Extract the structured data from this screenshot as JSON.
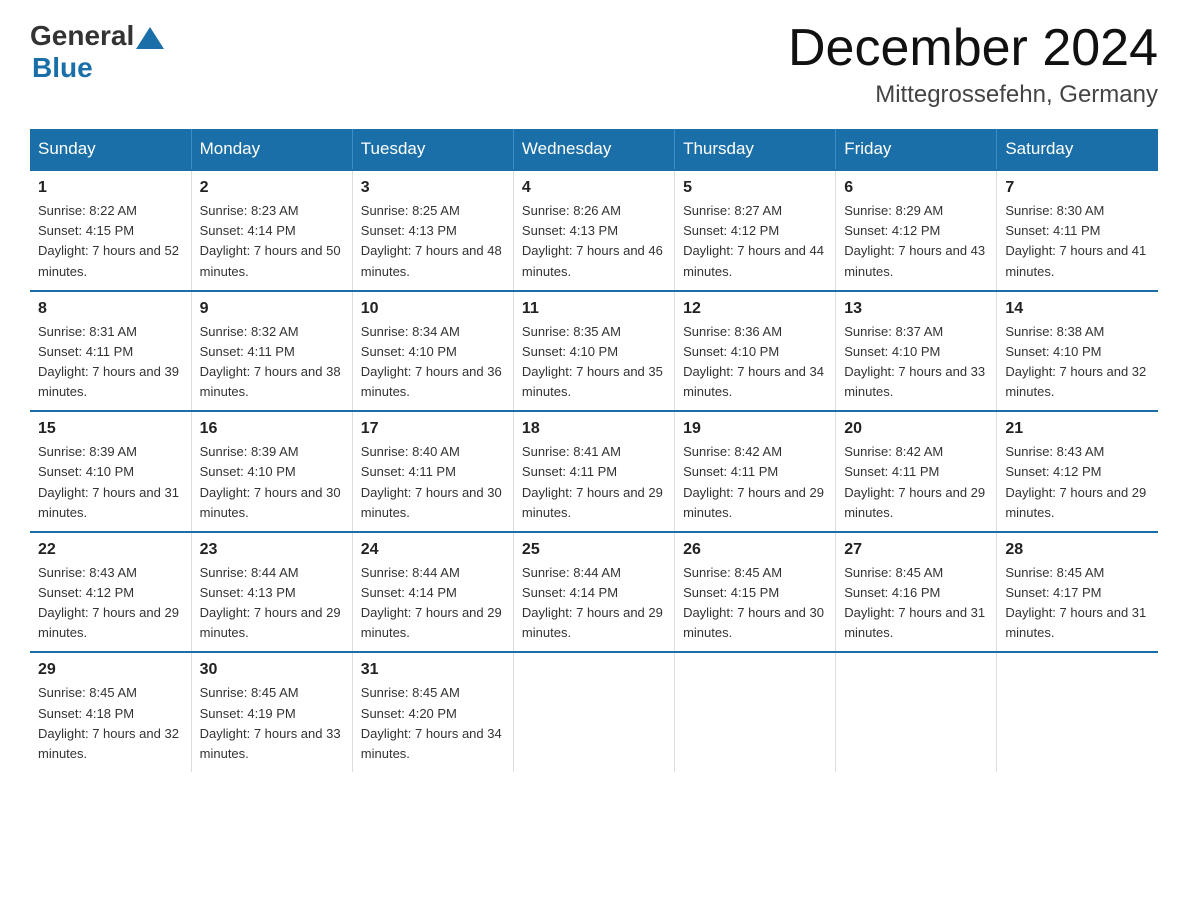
{
  "header": {
    "logo_general": "General",
    "logo_blue": "Blue",
    "month_title": "December 2024",
    "location": "Mittegrossefehn, Germany"
  },
  "weekdays": [
    "Sunday",
    "Monday",
    "Tuesday",
    "Wednesday",
    "Thursday",
    "Friday",
    "Saturday"
  ],
  "weeks": [
    [
      {
        "day": "1",
        "sunrise": "Sunrise: 8:22 AM",
        "sunset": "Sunset: 4:15 PM",
        "daylight": "Daylight: 7 hours and 52 minutes."
      },
      {
        "day": "2",
        "sunrise": "Sunrise: 8:23 AM",
        "sunset": "Sunset: 4:14 PM",
        "daylight": "Daylight: 7 hours and 50 minutes."
      },
      {
        "day": "3",
        "sunrise": "Sunrise: 8:25 AM",
        "sunset": "Sunset: 4:13 PM",
        "daylight": "Daylight: 7 hours and 48 minutes."
      },
      {
        "day": "4",
        "sunrise": "Sunrise: 8:26 AM",
        "sunset": "Sunset: 4:13 PM",
        "daylight": "Daylight: 7 hours and 46 minutes."
      },
      {
        "day": "5",
        "sunrise": "Sunrise: 8:27 AM",
        "sunset": "Sunset: 4:12 PM",
        "daylight": "Daylight: 7 hours and 44 minutes."
      },
      {
        "day": "6",
        "sunrise": "Sunrise: 8:29 AM",
        "sunset": "Sunset: 4:12 PM",
        "daylight": "Daylight: 7 hours and 43 minutes."
      },
      {
        "day": "7",
        "sunrise": "Sunrise: 8:30 AM",
        "sunset": "Sunset: 4:11 PM",
        "daylight": "Daylight: 7 hours and 41 minutes."
      }
    ],
    [
      {
        "day": "8",
        "sunrise": "Sunrise: 8:31 AM",
        "sunset": "Sunset: 4:11 PM",
        "daylight": "Daylight: 7 hours and 39 minutes."
      },
      {
        "day": "9",
        "sunrise": "Sunrise: 8:32 AM",
        "sunset": "Sunset: 4:11 PM",
        "daylight": "Daylight: 7 hours and 38 minutes."
      },
      {
        "day": "10",
        "sunrise": "Sunrise: 8:34 AM",
        "sunset": "Sunset: 4:10 PM",
        "daylight": "Daylight: 7 hours and 36 minutes."
      },
      {
        "day": "11",
        "sunrise": "Sunrise: 8:35 AM",
        "sunset": "Sunset: 4:10 PM",
        "daylight": "Daylight: 7 hours and 35 minutes."
      },
      {
        "day": "12",
        "sunrise": "Sunrise: 8:36 AM",
        "sunset": "Sunset: 4:10 PM",
        "daylight": "Daylight: 7 hours and 34 minutes."
      },
      {
        "day": "13",
        "sunrise": "Sunrise: 8:37 AM",
        "sunset": "Sunset: 4:10 PM",
        "daylight": "Daylight: 7 hours and 33 minutes."
      },
      {
        "day": "14",
        "sunrise": "Sunrise: 8:38 AM",
        "sunset": "Sunset: 4:10 PM",
        "daylight": "Daylight: 7 hours and 32 minutes."
      }
    ],
    [
      {
        "day": "15",
        "sunrise": "Sunrise: 8:39 AM",
        "sunset": "Sunset: 4:10 PM",
        "daylight": "Daylight: 7 hours and 31 minutes."
      },
      {
        "day": "16",
        "sunrise": "Sunrise: 8:39 AM",
        "sunset": "Sunset: 4:10 PM",
        "daylight": "Daylight: 7 hours and 30 minutes."
      },
      {
        "day": "17",
        "sunrise": "Sunrise: 8:40 AM",
        "sunset": "Sunset: 4:11 PM",
        "daylight": "Daylight: 7 hours and 30 minutes."
      },
      {
        "day": "18",
        "sunrise": "Sunrise: 8:41 AM",
        "sunset": "Sunset: 4:11 PM",
        "daylight": "Daylight: 7 hours and 29 minutes."
      },
      {
        "day": "19",
        "sunrise": "Sunrise: 8:42 AM",
        "sunset": "Sunset: 4:11 PM",
        "daylight": "Daylight: 7 hours and 29 minutes."
      },
      {
        "day": "20",
        "sunrise": "Sunrise: 8:42 AM",
        "sunset": "Sunset: 4:11 PM",
        "daylight": "Daylight: 7 hours and 29 minutes."
      },
      {
        "day": "21",
        "sunrise": "Sunrise: 8:43 AM",
        "sunset": "Sunset: 4:12 PM",
        "daylight": "Daylight: 7 hours and 29 minutes."
      }
    ],
    [
      {
        "day": "22",
        "sunrise": "Sunrise: 8:43 AM",
        "sunset": "Sunset: 4:12 PM",
        "daylight": "Daylight: 7 hours and 29 minutes."
      },
      {
        "day": "23",
        "sunrise": "Sunrise: 8:44 AM",
        "sunset": "Sunset: 4:13 PM",
        "daylight": "Daylight: 7 hours and 29 minutes."
      },
      {
        "day": "24",
        "sunrise": "Sunrise: 8:44 AM",
        "sunset": "Sunset: 4:14 PM",
        "daylight": "Daylight: 7 hours and 29 minutes."
      },
      {
        "day": "25",
        "sunrise": "Sunrise: 8:44 AM",
        "sunset": "Sunset: 4:14 PM",
        "daylight": "Daylight: 7 hours and 29 minutes."
      },
      {
        "day": "26",
        "sunrise": "Sunrise: 8:45 AM",
        "sunset": "Sunset: 4:15 PM",
        "daylight": "Daylight: 7 hours and 30 minutes."
      },
      {
        "day": "27",
        "sunrise": "Sunrise: 8:45 AM",
        "sunset": "Sunset: 4:16 PM",
        "daylight": "Daylight: 7 hours and 31 minutes."
      },
      {
        "day": "28",
        "sunrise": "Sunrise: 8:45 AM",
        "sunset": "Sunset: 4:17 PM",
        "daylight": "Daylight: 7 hours and 31 minutes."
      }
    ],
    [
      {
        "day": "29",
        "sunrise": "Sunrise: 8:45 AM",
        "sunset": "Sunset: 4:18 PM",
        "daylight": "Daylight: 7 hours and 32 minutes."
      },
      {
        "day": "30",
        "sunrise": "Sunrise: 8:45 AM",
        "sunset": "Sunset: 4:19 PM",
        "daylight": "Daylight: 7 hours and 33 minutes."
      },
      {
        "day": "31",
        "sunrise": "Sunrise: 8:45 AM",
        "sunset": "Sunset: 4:20 PM",
        "daylight": "Daylight: 7 hours and 34 minutes."
      },
      null,
      null,
      null,
      null
    ]
  ]
}
